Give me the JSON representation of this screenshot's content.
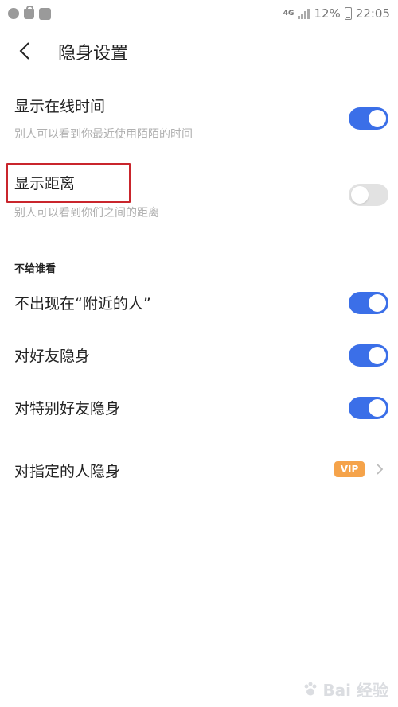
{
  "status_bar": {
    "network": "4G",
    "battery_percent": "12%",
    "time": "22:05"
  },
  "header": {
    "title": "隐身设置"
  },
  "settings": [
    {
      "title": "显示在线时间",
      "subtitle": "别人可以看到你最近使用陌陌的时间",
      "on": true
    },
    {
      "title": "显示距离",
      "subtitle": "别人可以看到你们之间的距离",
      "on": false
    }
  ],
  "section": {
    "label": "不给谁看"
  },
  "hide_from": [
    {
      "title": "不出现在“附近的人”",
      "on": true
    },
    {
      "title": "对好友隐身",
      "on": true
    },
    {
      "title": "对特别好友隐身",
      "on": true
    }
  ],
  "specific": {
    "title": "对指定的人隐身",
    "badge": "VIP"
  },
  "watermark": {
    "text": "Bai 经验"
  },
  "colors": {
    "toggle_on": "#3b6fe8",
    "toggle_off": "#e2e2e2",
    "vip_badge": "#f5a34a",
    "highlight": "#c9252c"
  },
  "icons": {
    "back": "chevron-left-icon",
    "arrow": "chevron-right-icon"
  }
}
